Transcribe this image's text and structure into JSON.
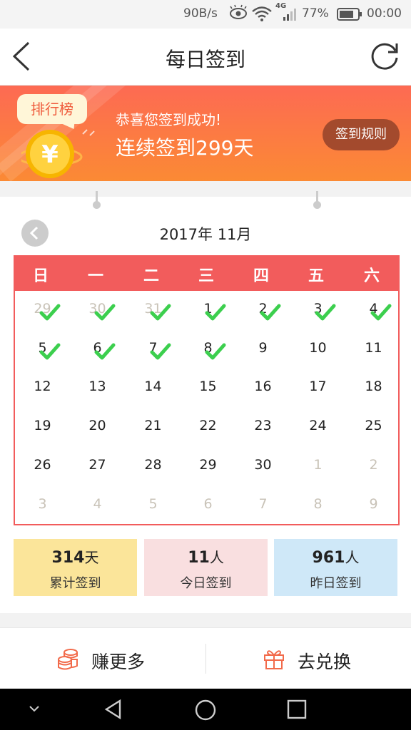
{
  "status_bar": {
    "speed": "90B/s",
    "network": "4G",
    "battery": "77%",
    "time": "00:00"
  },
  "header": {
    "title": "每日签到"
  },
  "banner": {
    "rank_label": "排行榜",
    "success_text": "恭喜您签到成功!",
    "streak_text": "连续签到299天",
    "rules_button": "签到规则"
  },
  "calendar": {
    "month_label": "2017年 11月",
    "weekdays": [
      "日",
      "一",
      "二",
      "三",
      "四",
      "五",
      "六"
    ],
    "weeks": [
      [
        {
          "d": "29",
          "muted": true,
          "checked": true
        },
        {
          "d": "30",
          "muted": true,
          "checked": true
        },
        {
          "d": "31",
          "muted": true,
          "checked": true
        },
        {
          "d": "1",
          "muted": false,
          "checked": true
        },
        {
          "d": "2",
          "muted": false,
          "checked": true
        },
        {
          "d": "3",
          "muted": false,
          "checked": true
        },
        {
          "d": "4",
          "muted": false,
          "checked": true
        }
      ],
      [
        {
          "d": "5",
          "muted": false,
          "checked": true
        },
        {
          "d": "6",
          "muted": false,
          "checked": true
        },
        {
          "d": "7",
          "muted": false,
          "checked": true
        },
        {
          "d": "8",
          "muted": false,
          "checked": true
        },
        {
          "d": "9",
          "muted": false,
          "checked": false
        },
        {
          "d": "10",
          "muted": false,
          "checked": false
        },
        {
          "d": "11",
          "muted": false,
          "checked": false
        }
      ],
      [
        {
          "d": "12",
          "muted": false,
          "checked": false
        },
        {
          "d": "13",
          "muted": false,
          "checked": false
        },
        {
          "d": "14",
          "muted": false,
          "checked": false
        },
        {
          "d": "15",
          "muted": false,
          "checked": false
        },
        {
          "d": "16",
          "muted": false,
          "checked": false
        },
        {
          "d": "17",
          "muted": false,
          "checked": false
        },
        {
          "d": "18",
          "muted": false,
          "checked": false
        }
      ],
      [
        {
          "d": "19",
          "muted": false,
          "checked": false
        },
        {
          "d": "20",
          "muted": false,
          "checked": false
        },
        {
          "d": "21",
          "muted": false,
          "checked": false
        },
        {
          "d": "22",
          "muted": false,
          "checked": false
        },
        {
          "d": "23",
          "muted": false,
          "checked": false
        },
        {
          "d": "24",
          "muted": false,
          "checked": false
        },
        {
          "d": "25",
          "muted": false,
          "checked": false
        }
      ],
      [
        {
          "d": "26",
          "muted": false,
          "checked": false
        },
        {
          "d": "27",
          "muted": false,
          "checked": false
        },
        {
          "d": "28",
          "muted": false,
          "checked": false
        },
        {
          "d": "29",
          "muted": false,
          "checked": false
        },
        {
          "d": "30",
          "muted": false,
          "checked": false
        },
        {
          "d": "1",
          "muted": true,
          "checked": false
        },
        {
          "d": "2",
          "muted": true,
          "checked": false
        }
      ],
      [
        {
          "d": "3",
          "muted": true,
          "checked": false
        },
        {
          "d": "4",
          "muted": true,
          "checked": false
        },
        {
          "d": "5",
          "muted": true,
          "checked": false
        },
        {
          "d": "6",
          "muted": true,
          "checked": false
        },
        {
          "d": "7",
          "muted": true,
          "checked": false
        },
        {
          "d": "8",
          "muted": true,
          "checked": false
        },
        {
          "d": "9",
          "muted": true,
          "checked": false
        }
      ]
    ]
  },
  "stats": [
    {
      "value": "314",
      "unit": "天",
      "label": "累计签到"
    },
    {
      "value": "11",
      "unit": "人",
      "label": "今日签到"
    },
    {
      "value": "961",
      "unit": "人",
      "label": "昨日签到"
    }
  ],
  "bottom_bar": {
    "earn_label": "赚更多",
    "redeem_label": "去兑换"
  },
  "colors": {
    "accent_red": "#f25c5c",
    "check_green": "#3ccf4e",
    "icon_orange": "#f26a4a"
  }
}
